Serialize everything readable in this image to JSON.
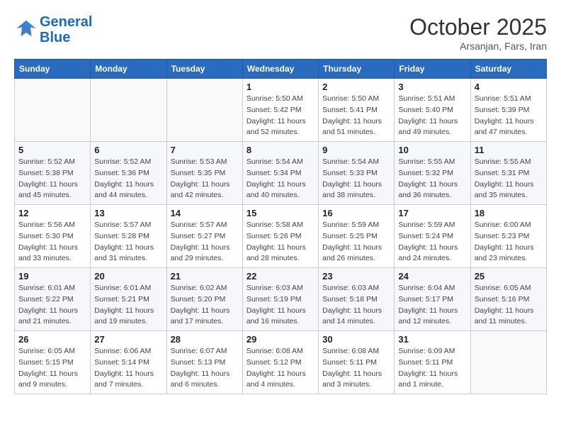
{
  "header": {
    "logo_line1": "General",
    "logo_line2": "Blue",
    "month": "October 2025",
    "location": "Arsanjan, Fars, Iran"
  },
  "weekdays": [
    "Sunday",
    "Monday",
    "Tuesday",
    "Wednesday",
    "Thursday",
    "Friday",
    "Saturday"
  ],
  "weeks": [
    [
      {
        "day": "",
        "info": ""
      },
      {
        "day": "",
        "info": ""
      },
      {
        "day": "",
        "info": ""
      },
      {
        "day": "1",
        "info": "Sunrise: 5:50 AM\nSunset: 5:42 PM\nDaylight: 11 hours\nand 52 minutes."
      },
      {
        "day": "2",
        "info": "Sunrise: 5:50 AM\nSunset: 5:41 PM\nDaylight: 11 hours\nand 51 minutes."
      },
      {
        "day": "3",
        "info": "Sunrise: 5:51 AM\nSunset: 5:40 PM\nDaylight: 11 hours\nand 49 minutes."
      },
      {
        "day": "4",
        "info": "Sunrise: 5:51 AM\nSunset: 5:39 PM\nDaylight: 11 hours\nand 47 minutes."
      }
    ],
    [
      {
        "day": "5",
        "info": "Sunrise: 5:52 AM\nSunset: 5:38 PM\nDaylight: 11 hours\nand 45 minutes."
      },
      {
        "day": "6",
        "info": "Sunrise: 5:52 AM\nSunset: 5:36 PM\nDaylight: 11 hours\nand 44 minutes."
      },
      {
        "day": "7",
        "info": "Sunrise: 5:53 AM\nSunset: 5:35 PM\nDaylight: 11 hours\nand 42 minutes."
      },
      {
        "day": "8",
        "info": "Sunrise: 5:54 AM\nSunset: 5:34 PM\nDaylight: 11 hours\nand 40 minutes."
      },
      {
        "day": "9",
        "info": "Sunrise: 5:54 AM\nSunset: 5:33 PM\nDaylight: 11 hours\nand 38 minutes."
      },
      {
        "day": "10",
        "info": "Sunrise: 5:55 AM\nSunset: 5:32 PM\nDaylight: 11 hours\nand 36 minutes."
      },
      {
        "day": "11",
        "info": "Sunrise: 5:55 AM\nSunset: 5:31 PM\nDaylight: 11 hours\nand 35 minutes."
      }
    ],
    [
      {
        "day": "12",
        "info": "Sunrise: 5:56 AM\nSunset: 5:30 PM\nDaylight: 11 hours\nand 33 minutes."
      },
      {
        "day": "13",
        "info": "Sunrise: 5:57 AM\nSunset: 5:28 PM\nDaylight: 11 hours\nand 31 minutes."
      },
      {
        "day": "14",
        "info": "Sunrise: 5:57 AM\nSunset: 5:27 PM\nDaylight: 11 hours\nand 29 minutes."
      },
      {
        "day": "15",
        "info": "Sunrise: 5:58 AM\nSunset: 5:26 PM\nDaylight: 11 hours\nand 28 minutes."
      },
      {
        "day": "16",
        "info": "Sunrise: 5:59 AM\nSunset: 5:25 PM\nDaylight: 11 hours\nand 26 minutes."
      },
      {
        "day": "17",
        "info": "Sunrise: 5:59 AM\nSunset: 5:24 PM\nDaylight: 11 hours\nand 24 minutes."
      },
      {
        "day": "18",
        "info": "Sunrise: 6:00 AM\nSunset: 5:23 PM\nDaylight: 11 hours\nand 23 minutes."
      }
    ],
    [
      {
        "day": "19",
        "info": "Sunrise: 6:01 AM\nSunset: 5:22 PM\nDaylight: 11 hours\nand 21 minutes."
      },
      {
        "day": "20",
        "info": "Sunrise: 6:01 AM\nSunset: 5:21 PM\nDaylight: 11 hours\nand 19 minutes."
      },
      {
        "day": "21",
        "info": "Sunrise: 6:02 AM\nSunset: 5:20 PM\nDaylight: 11 hours\nand 17 minutes."
      },
      {
        "day": "22",
        "info": "Sunrise: 6:03 AM\nSunset: 5:19 PM\nDaylight: 11 hours\nand 16 minutes."
      },
      {
        "day": "23",
        "info": "Sunrise: 6:03 AM\nSunset: 5:18 PM\nDaylight: 11 hours\nand 14 minutes."
      },
      {
        "day": "24",
        "info": "Sunrise: 6:04 AM\nSunset: 5:17 PM\nDaylight: 11 hours\nand 12 minutes."
      },
      {
        "day": "25",
        "info": "Sunrise: 6:05 AM\nSunset: 5:16 PM\nDaylight: 11 hours\nand 11 minutes."
      }
    ],
    [
      {
        "day": "26",
        "info": "Sunrise: 6:05 AM\nSunset: 5:15 PM\nDaylight: 11 hours\nand 9 minutes."
      },
      {
        "day": "27",
        "info": "Sunrise: 6:06 AM\nSunset: 5:14 PM\nDaylight: 11 hours\nand 7 minutes."
      },
      {
        "day": "28",
        "info": "Sunrise: 6:07 AM\nSunset: 5:13 PM\nDaylight: 11 hours\nand 6 minutes."
      },
      {
        "day": "29",
        "info": "Sunrise: 6:08 AM\nSunset: 5:12 PM\nDaylight: 11 hours\nand 4 minutes."
      },
      {
        "day": "30",
        "info": "Sunrise: 6:08 AM\nSunset: 5:11 PM\nDaylight: 11 hours\nand 3 minutes."
      },
      {
        "day": "31",
        "info": "Sunrise: 6:09 AM\nSunset: 5:11 PM\nDaylight: 11 hours\nand 1 minute."
      },
      {
        "day": "",
        "info": ""
      }
    ]
  ]
}
